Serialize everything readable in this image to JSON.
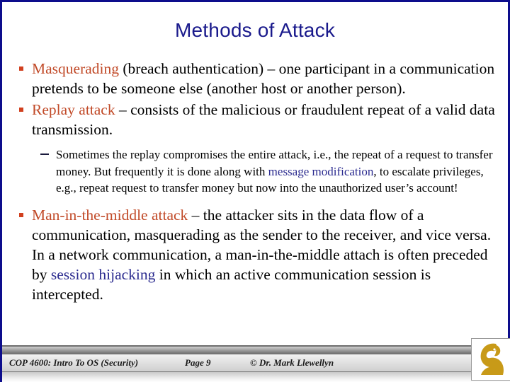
{
  "slide": {
    "title": "Methods of Attack",
    "border_color": "#0d0d8c",
    "title_color": "#1a1a8c",
    "highlight_red": "#c14a28",
    "highlight_blue": "#2b2b8f",
    "bullet_color": "#d1401f"
  },
  "bullets": [
    {
      "level": 1,
      "term": "Masquerading",
      "term_color": "red",
      "text": " (breach authentication) – one participant in a communication pretends to be someone else (another host or another person)."
    },
    {
      "level": 1,
      "term": "Replay attack",
      "term_color": "red",
      "text": " – consists of the malicious or fraudulent repeat of a valid data transmission."
    },
    {
      "level": 2,
      "part1": "Sometimes the replay compromises the entire attack, i.e., the repeat of a request to transfer money.  But frequently it is done along with ",
      "highlight": "message modification",
      "highlight_color": "blue",
      "part2": ", to escalate privileges, e.g., repeat request to transfer money but now into the unauthorized user’s account!"
    },
    {
      "level": 1,
      "term": "Man-in-the-middle attack",
      "term_color": "red",
      "part1": " – the attacker sits in the data flow of a communication, masquerading as the sender to the receiver, and vice versa.  In a network communication, a man-in-the-middle attach is often preceded by ",
      "highlight": "session hijacking",
      "highlight_color": "blue",
      "part2": " in which an active communication session is intercepted."
    }
  ],
  "footer": {
    "course": "COP 4600: Intro To OS  (Security)",
    "page": "Page 9",
    "copyright": "© Dr. Mark Llewellyn",
    "logo": "ucf-pegasus-logo",
    "logo_color": "#c89a18"
  }
}
